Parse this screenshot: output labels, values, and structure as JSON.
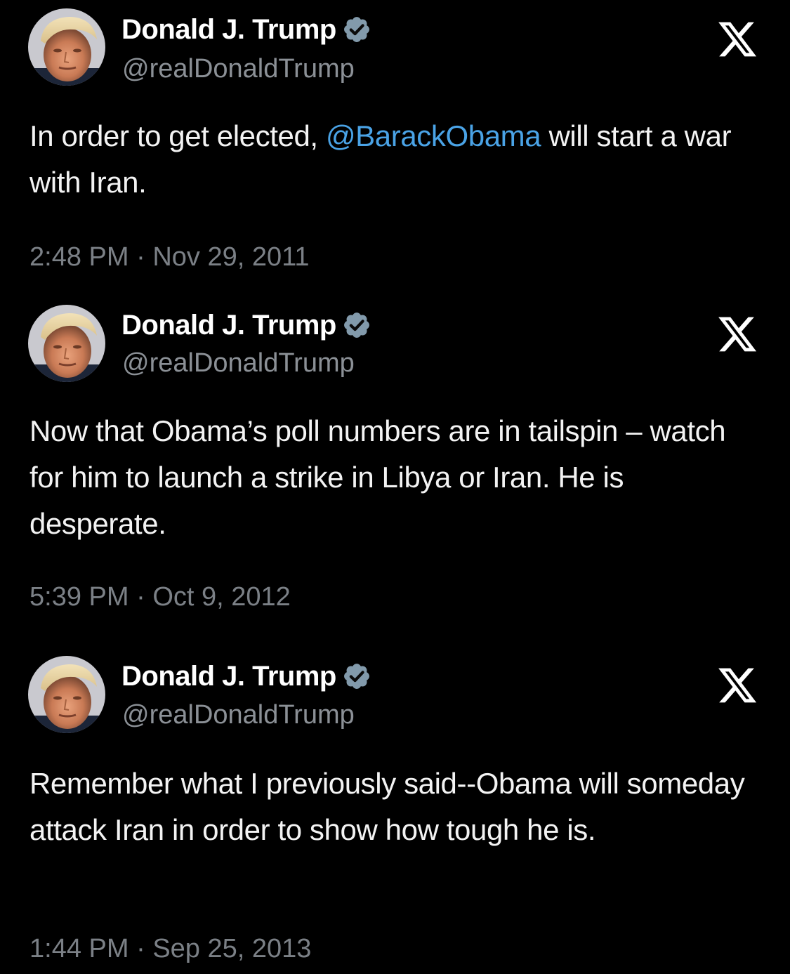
{
  "tweets": [
    {
      "author": {
        "display_name": "Donald J. Trump",
        "handle": "@realDonaldTrump",
        "verified_icon": "verified-badge-icon"
      },
      "text_before": "In order to get elected, ",
      "mention": "@BarackObama",
      "text_after": " will start a war with Iran.",
      "time": "2:48 PM",
      "separator": "·",
      "date": "Nov 29, 2011",
      "platform_icon": "x-logo-icon"
    },
    {
      "author": {
        "display_name": "Donald J. Trump",
        "handle": "@realDonaldTrump",
        "verified_icon": "verified-badge-icon"
      },
      "text": "Now that Obama’s poll numbers are in tailspin – watch for him to launch a strike in Libya or Iran. He is desperate.",
      "time": "5:39 PM",
      "separator": "·",
      "date": "Oct 9, 2012",
      "platform_icon": "x-logo-icon"
    },
    {
      "author": {
        "display_name": "Donald J. Trump",
        "handle": "@realDonaldTrump",
        "verified_icon": "verified-badge-icon"
      },
      "text": "Remember what I previously said--Obama will someday attack Iran in order to show how tough he is.",
      "time": "1:44 PM",
      "separator": "·",
      "date": "Sep 25, 2013",
      "platform_icon": "x-logo-icon"
    }
  ],
  "colors": {
    "background": "#000000",
    "name": "#ffffff",
    "handle": "#8b9096",
    "body_text": "#f3f3f3",
    "mention": "#4aa3e6",
    "timestamp": "#7b8086",
    "verified_badge": "#829aab"
  }
}
